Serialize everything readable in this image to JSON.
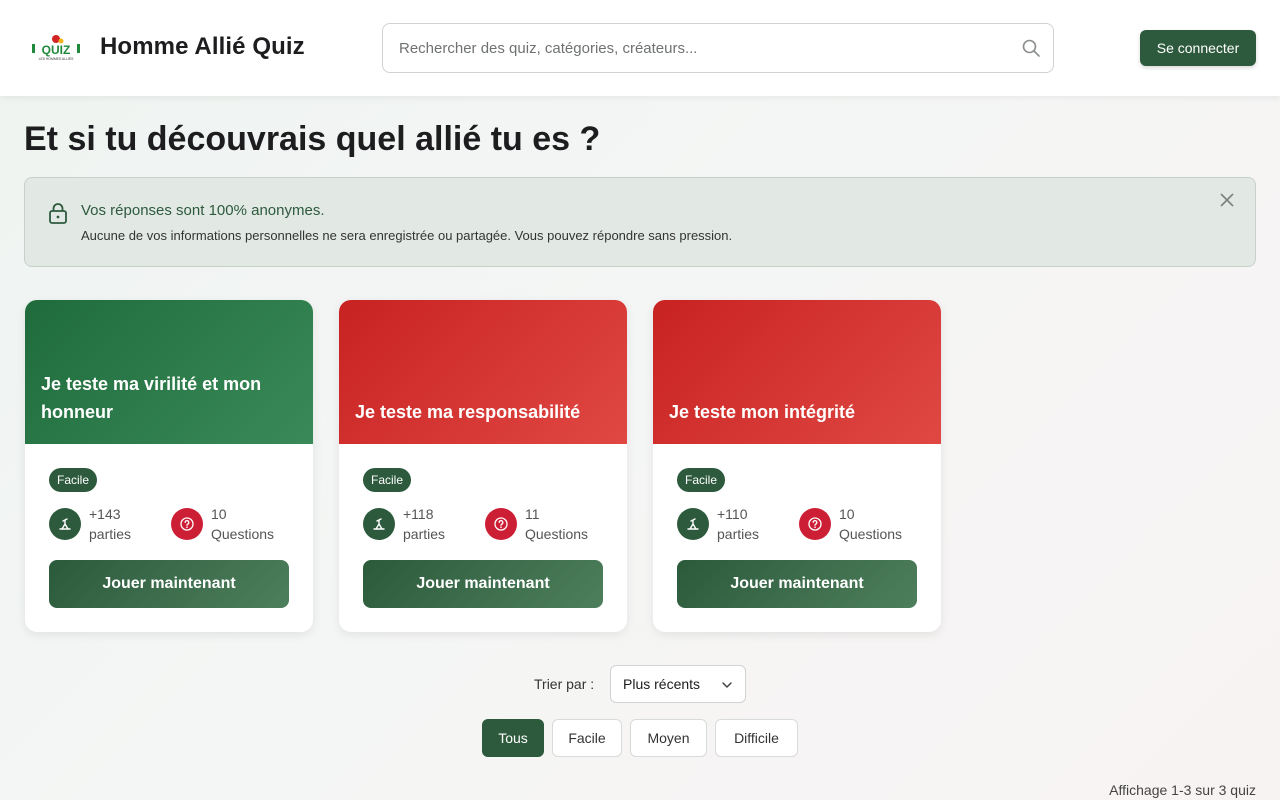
{
  "header": {
    "logo_text": "QUIZ",
    "logo_subtext": "LES HOMMES ALLIÉS",
    "brand": "Homme Allié Quiz",
    "search_placeholder": "Rechercher des quiz, catégories, créateurs...",
    "login_label": "Se connecter"
  },
  "page": {
    "title": "Et si tu découvrais quel allié tu es ?"
  },
  "notice": {
    "title": "Vos réponses sont 100% anonymes.",
    "text": "Aucune de vos informations personnelles ne sera enregistrée ou partagée. Vous pouvez répondre sans pression."
  },
  "colors": {
    "primary": "#2d5a3d",
    "green_card": "#1f6b3c",
    "red_card": "#c82222",
    "question_icon": "#cc1f36"
  },
  "cards": [
    {
      "title": "Je teste ma virilité et mon honneur",
      "theme": "green",
      "difficulty": "Facile",
      "plays": "+143",
      "plays_label": "parties",
      "questions": "10",
      "questions_label": "Questions",
      "cta": "Jouer maintenant"
    },
    {
      "title": "Je teste ma responsabilité",
      "theme": "red",
      "difficulty": "Facile",
      "plays": "+118",
      "plays_label": "parties",
      "questions": "11",
      "questions_label": "Questions",
      "cta": "Jouer maintenant"
    },
    {
      "title": "Je teste mon intégrité",
      "theme": "red",
      "difficulty": "Facile",
      "plays": "+110",
      "plays_label": "parties",
      "questions": "10",
      "questions_label": "Questions",
      "cta": "Jouer maintenant"
    }
  ],
  "sort": {
    "label": "Trier par :",
    "selected": "Plus récents"
  },
  "filters": [
    "Tous",
    "Facile",
    "Moyen",
    "Difficile"
  ],
  "active_filter": "Tous",
  "footer": {
    "count_text": "Affichage 1-3 sur 3 quiz"
  }
}
